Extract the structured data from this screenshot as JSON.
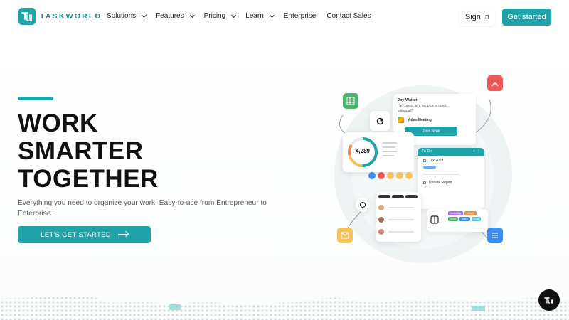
{
  "brand": {
    "name": "TASKWORLD",
    "accent": "#1fa3a8"
  },
  "nav": {
    "items": [
      {
        "label": "Solutions",
        "dropdown": true
      },
      {
        "label": "Features",
        "dropdown": true
      },
      {
        "label": "Pricing",
        "dropdown": true
      },
      {
        "label": "Learn",
        "dropdown": true
      },
      {
        "label": "Enterprise",
        "dropdown": false
      },
      {
        "label": "Contact Sales",
        "dropdown": false
      }
    ],
    "signin_label": "Sign In",
    "getstarted_label": "Get started"
  },
  "hero": {
    "headline": [
      "WORK",
      "SMARTER",
      "TOGETHER"
    ],
    "subtext": "Everything you need to organize your work. Easy-to-use from Entrepreneur to Enterprise.",
    "cta_label": "LET'S GET STARTED"
  },
  "illustration": {
    "chat_name": "Joy Walter",
    "chat_message": "Hey guys, let's jump on a quick videocall?",
    "meeting_label": "Video Meeting",
    "join_label": "Join Now",
    "todo_title": "To Do",
    "task_1": "Tax 2023",
    "task_2": "Update Report",
    "stat_value": "4,289",
    "tags": [
      "marketing",
      "design",
      "email",
      "sales",
      "bugs"
    ]
  },
  "chat_widget": {
    "icon": "taskworld-chat-icon",
    "label": "TW"
  }
}
